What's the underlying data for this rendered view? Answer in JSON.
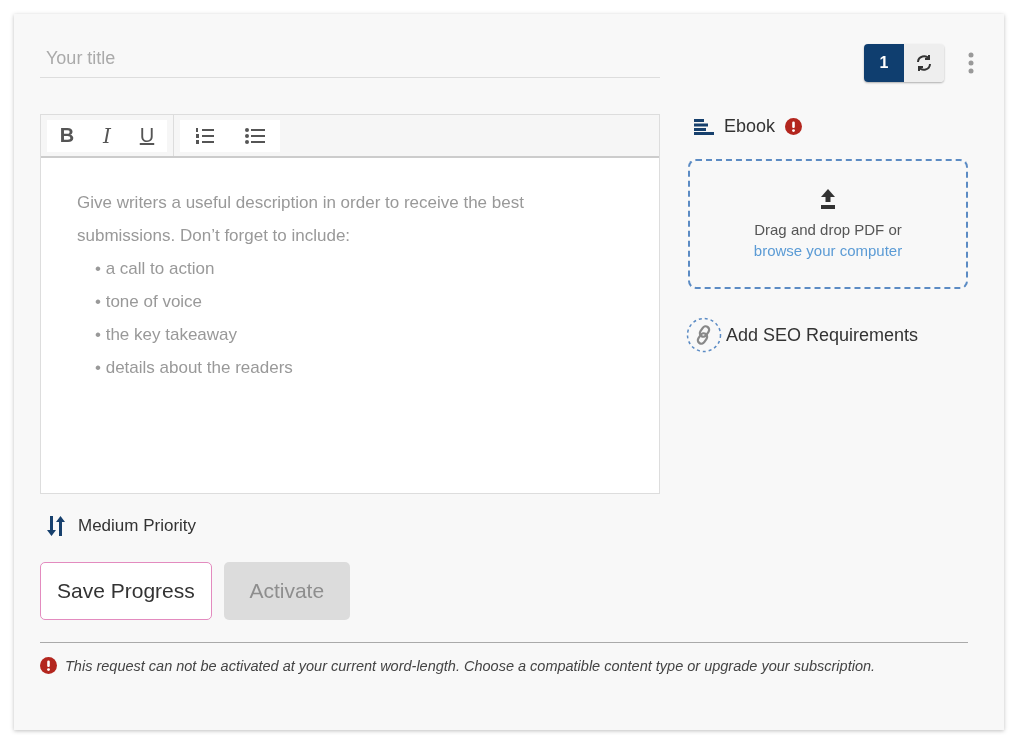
{
  "title_field": {
    "placeholder": "Your title"
  },
  "counter": {
    "value": "1"
  },
  "toolbar": [
    {
      "kind": "bold",
      "label": "B"
    },
    {
      "kind": "italic",
      "label": "I"
    },
    {
      "kind": "underline",
      "label": "U"
    },
    {
      "kind": "ordered-list"
    },
    {
      "kind": "bullet-list"
    }
  ],
  "editor": {
    "hint": "Give writers a useful description in order to receive the best submissions. Don’t forget to include:",
    "hint_points": [
      "• a call to action",
      "• tone of voice",
      "• the key takeaway",
      "• details about the readers"
    ]
  },
  "content_type": {
    "label": "Ebook",
    "warning": true
  },
  "upload": {
    "text": "Drag and drop PDF or",
    "link": "browse your computer"
  },
  "seo_link": "Add SEO Requirements",
  "priority": "Medium Priority",
  "buttons": [
    {
      "label": "Save Progress",
      "disabled": false
    },
    {
      "label": "Activate",
      "disabled": true
    }
  ],
  "error": "This request can not be activated at your current word-length. Choose a compatible content type or upgrade your subscription."
}
